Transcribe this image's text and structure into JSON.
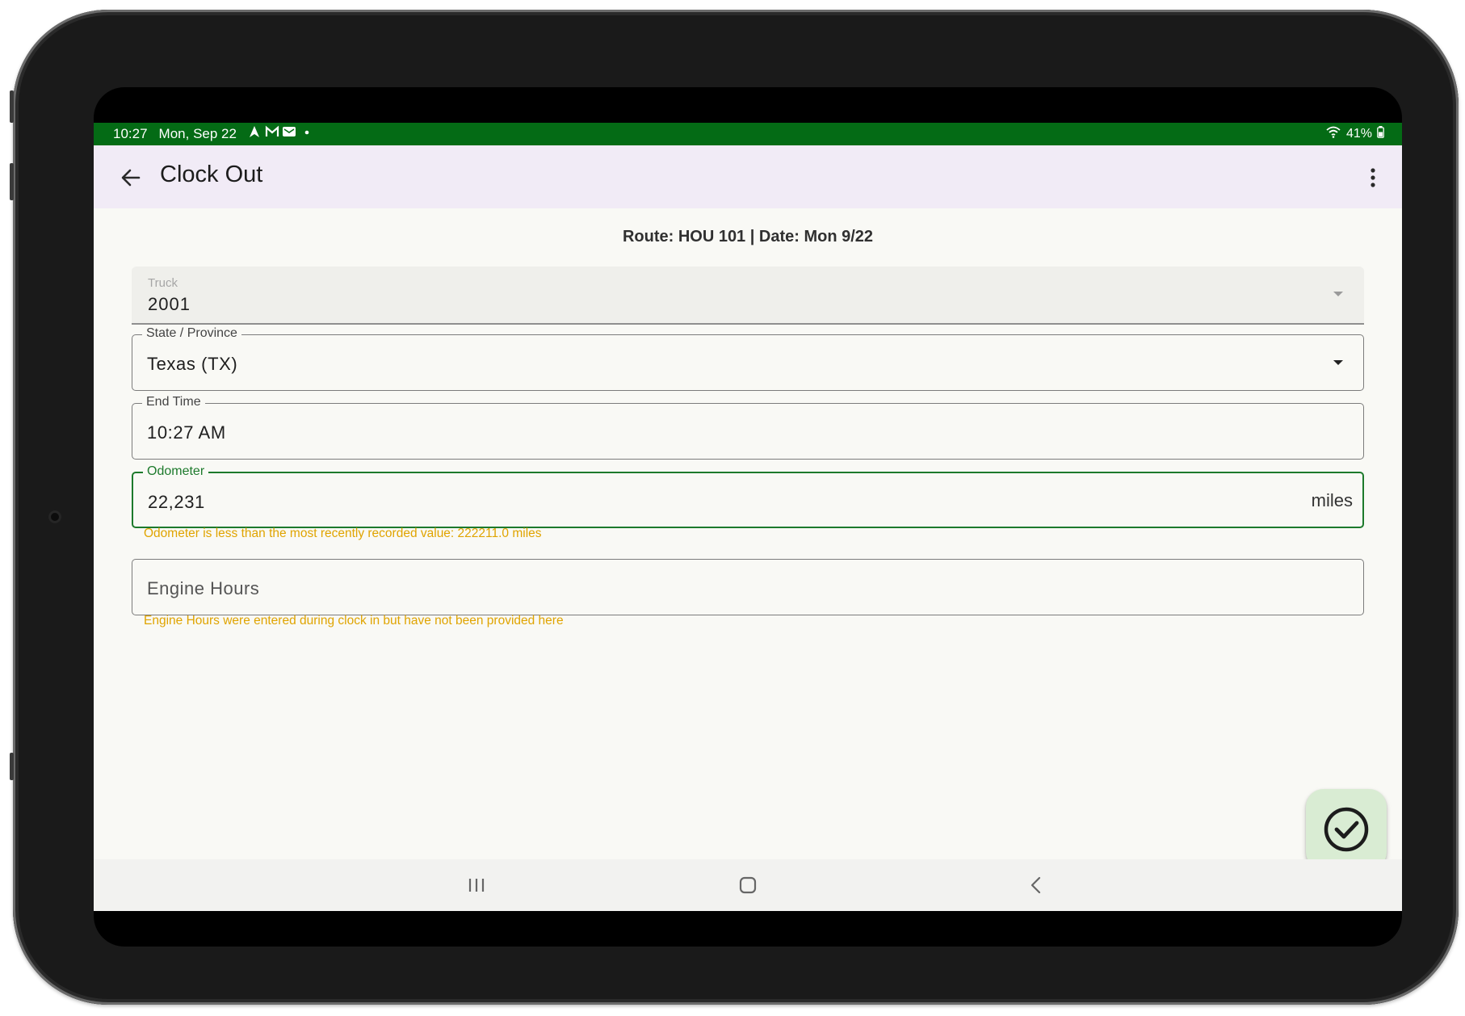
{
  "status_bar": {
    "time": "10:27",
    "date": "Mon, Sep 22",
    "notification_icons": [
      "navigation-icon",
      "gmail-icon",
      "email-icon",
      "dot-icon"
    ],
    "battery": "41%",
    "color": "#046b15"
  },
  "app_bar": {
    "title": "Clock Out",
    "background": "#f1ebf6"
  },
  "header": {
    "route_line": "Route: HOU 101 | Date: Mon 9/22"
  },
  "form": {
    "truck": {
      "label": "Truck",
      "value": "2001"
    },
    "state": {
      "label": "State / Province",
      "value": "Texas (TX)"
    },
    "end_time": {
      "label": "End Time",
      "value": "10:27 AM"
    },
    "odometer": {
      "label": "Odometer",
      "value": "22,231",
      "suffix": "miles",
      "warning": "Odometer is less than the most recently recorded value: 222211.0 miles"
    },
    "engine_hours": {
      "placeholder": "Engine Hours",
      "warning": "Engine Hours were entered during clock in but have not been provided here"
    }
  },
  "colors": {
    "accent_green": "#1d7a2c",
    "warning": "#e0a400",
    "fab_background": "#d9ecd3"
  }
}
